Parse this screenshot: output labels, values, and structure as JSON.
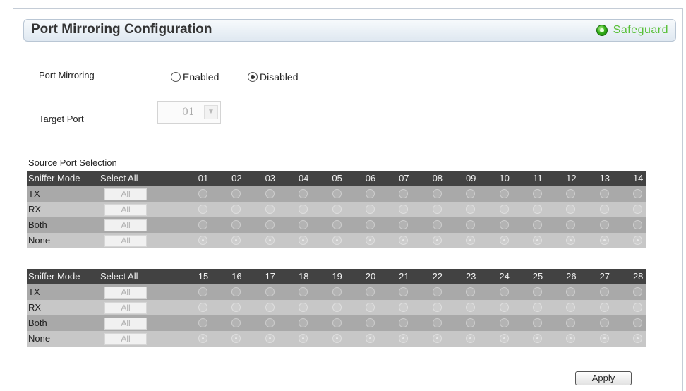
{
  "header": {
    "title": "Port Mirroring Configuration",
    "safeguard": "Safeguard"
  },
  "port_mirroring": {
    "label": "Port Mirroring",
    "options": [
      "Enabled",
      "Disabled"
    ],
    "selected": "Disabled"
  },
  "target_port": {
    "label": "Target Port",
    "value": "01"
  },
  "source": {
    "label": "Source Port Selection",
    "col_mode": "Sniffer Mode",
    "col_select_all": "Select All",
    "all_label": "All",
    "modes": [
      "TX",
      "RX",
      "Both",
      "None"
    ],
    "selected_mode": "None",
    "ports_group1": [
      "01",
      "02",
      "03",
      "04",
      "05",
      "06",
      "07",
      "08",
      "09",
      "10",
      "11",
      "12",
      "13",
      "14"
    ],
    "ports_group2": [
      "15",
      "16",
      "17",
      "18",
      "19",
      "20",
      "21",
      "22",
      "23",
      "24",
      "25",
      "26",
      "27",
      "28"
    ]
  },
  "apply_label": "Apply"
}
